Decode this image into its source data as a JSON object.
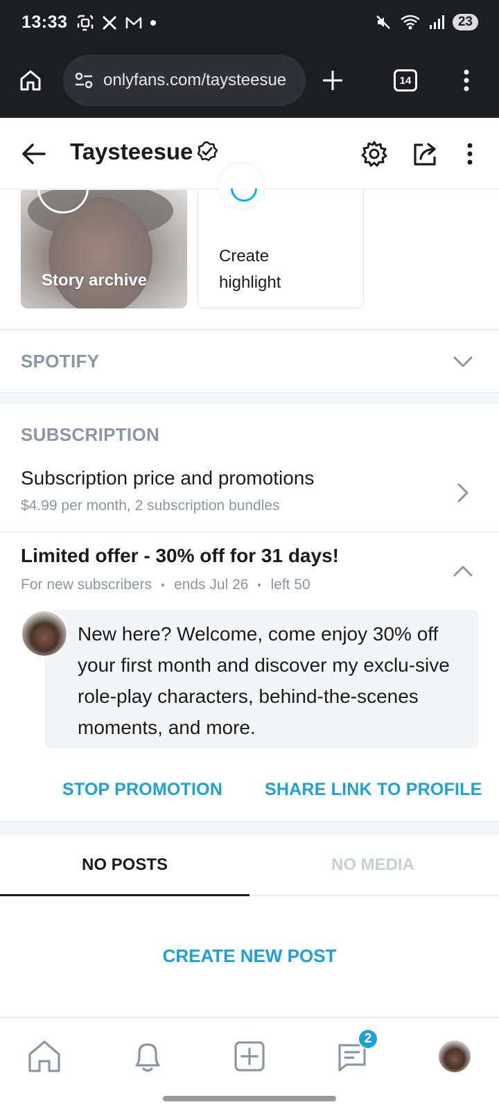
{
  "status_bar": {
    "time": "13:33",
    "battery": "23"
  },
  "browser": {
    "url": "onlyfans.com/taysteesue",
    "tab_count": "14"
  },
  "header": {
    "title": "Taysteesue"
  },
  "highlights": {
    "story_archive": "Story archive",
    "create_highlight": "Create highlight"
  },
  "spotify": {
    "label": "SPOTIFY"
  },
  "subscription": {
    "heading": "SUBSCRIPTION",
    "price_title": "Subscription price and promotions",
    "price_sub": "$4.99 per month, 2 subscription bundles"
  },
  "offer": {
    "title": "Limited offer - 30% off for 31 days!",
    "meta_audience": "For new subscribers",
    "meta_ends": "ends Jul 26",
    "meta_left": "left 50",
    "message": "New here? Welcome, come enjoy 30% off your first month and discover my exclu-sive role-play characters, behind-the-scenes moments, and more.",
    "stop_label": "STOP PROMOTION",
    "share_label": "SHARE LINK TO PROFILE"
  },
  "tabs": [
    {
      "label": "NO POSTS",
      "active": true
    },
    {
      "label": "NO MEDIA",
      "active": false
    }
  ],
  "create_post": "CREATE NEW POST",
  "bottom_nav": {
    "messages_badge": "2"
  },
  "colors": {
    "accent": "#00aff0",
    "link": "#1ea1d8",
    "muted": "#8a96a3"
  }
}
